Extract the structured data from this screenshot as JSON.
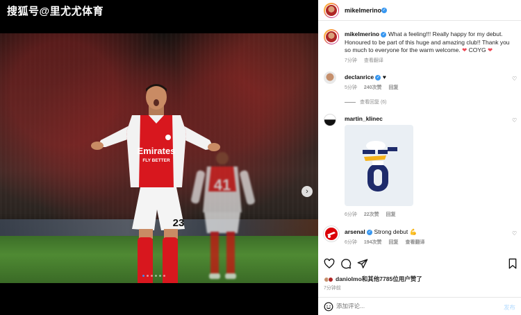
{
  "watermark": "搜狐号@里尤尤体育",
  "media": {
    "carousel_dots": 6,
    "active_dot": 0,
    "next_icon": "chevron-right-icon"
  },
  "player": {
    "shirt_sponsor": "Emirates",
    "shirt_sponsor_sub": "FLY BETTER",
    "shorts_number": "23",
    "back_number": "41"
  },
  "header": {
    "username": "mikelmerino",
    "options_icon": "more-dots-icon"
  },
  "caption": {
    "username": "mikelmerino",
    "text": "What a feeling!!! Really happy for my debut. Honoured to be part of this huge and amazing club!! Thank you so much to everyone for the warm welcome.",
    "tail": "COYG",
    "time": "7分钟",
    "translate": "查看翻译"
  },
  "comments": [
    {
      "username": "declanrice",
      "text": "♥",
      "time": "5分钟",
      "likes": "240次赞",
      "reply": "回复",
      "view_replies": "查看回复 (6)"
    },
    {
      "username": "martin_klinec",
      "time": "6分钟",
      "likes": "22次赞",
      "reply": "回复"
    },
    {
      "username": "arsenal",
      "text": "Strong debut 💪",
      "time": "6分钟",
      "likes": "194次赞",
      "reply": "回复",
      "translate": "查看翻译"
    }
  ],
  "likes_summary": {
    "user": "daniolmo",
    "rest": "和其他7785位用户赞了"
  },
  "post_time": "7分钟前",
  "comment_box": {
    "placeholder": "添加评论...",
    "post_label": "发布"
  },
  "colors": {
    "accent_blue": "#3897f0",
    "heart_red": "#ed4956",
    "arsenal_red": "#db0007"
  }
}
